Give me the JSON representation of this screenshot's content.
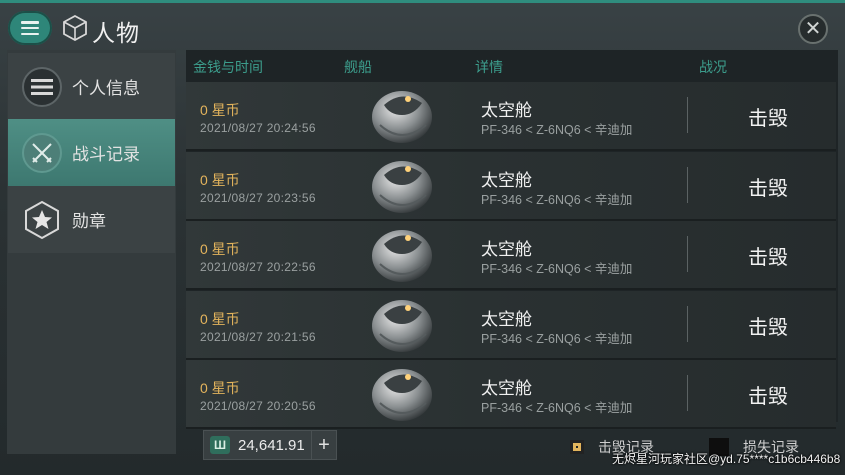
{
  "header": {
    "title": "人物",
    "menu_icon": "hamburger-icon",
    "close_icon": "close-icon"
  },
  "sidebar": {
    "items": [
      {
        "label": "个人信息",
        "icon": "list-icon",
        "active": false
      },
      {
        "label": "战斗记录",
        "icon": "crossed-swords-icon",
        "active": true
      },
      {
        "label": "勋章",
        "icon": "star-badge-icon",
        "active": false
      }
    ]
  },
  "table": {
    "headers": {
      "money_time": "金钱与时间",
      "ship": "舰船",
      "details": "详情",
      "result": "战况"
    },
    "rows": [
      {
        "money": "0 星币",
        "time": "2021/08/27  20:24:56",
        "ship_name": "太空舱",
        "route": "PF-346 < Z-6NQ6 < 辛迪加",
        "status": "击毁"
      },
      {
        "money": "0 星币",
        "time": "2021/08/27  20:23:56",
        "ship_name": "太空舱",
        "route": "PF-346 < Z-6NQ6 < 辛迪加",
        "status": "击毁"
      },
      {
        "money": "0 星币",
        "time": "2021/08/27  20:22:56",
        "ship_name": "太空舱",
        "route": "PF-346 < Z-6NQ6 < 辛迪加",
        "status": "击毁"
      },
      {
        "money": "0 星币",
        "time": "2021/08/27  20:21:56",
        "ship_name": "太空舱",
        "route": "PF-346 < Z-6NQ6 < 辛迪加",
        "status": "击毁"
      },
      {
        "money": "0 星币",
        "time": "2021/08/27  20:20:56",
        "ship_name": "太空舱",
        "route": "PF-346 < Z-6NQ6 < 辛迪加",
        "status": "击毁"
      }
    ]
  },
  "footer": {
    "currency_icon": "isk-currency-icon",
    "balance": "24,641.91",
    "plus_label": "+",
    "legend_kill": "击毁记录",
    "legend_loss": "损失记录"
  },
  "watermark": "无烬星河玩家社区@yd.75****c1b6cb446b8",
  "colors": {
    "accent": "#2e8679",
    "money": "#e3b45c",
    "header_text": "#3c9d8c",
    "kill_legend": "#e3b45c",
    "loss_legend": "#000000"
  }
}
